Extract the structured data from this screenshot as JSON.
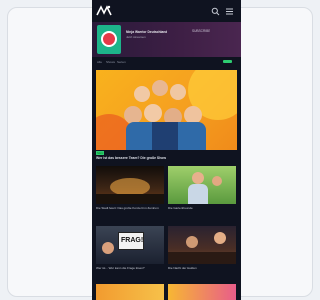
{
  "promo": {
    "title": "Ninja Warrior Deutschland",
    "subtitle": "Jetzt streamen",
    "cta": "SUBSCRIBE"
  },
  "sections": [
    "Alle",
    "Shows",
    "Serien"
  ],
  "hero": {
    "tag": "NEU",
    "caption": "Wer ist das bessere Team? Die große Show"
  },
  "tiles": [
    {
      "caption": "Die Stadt feiert: Das große Konzert im Zentrum",
      "sub": ""
    },
    {
      "caption": "Die Gartenfreunde",
      "sub": ""
    },
    {
      "caption": "Wer ist... Wer kann die Frage lösen?",
      "sub": ""
    },
    {
      "caption": "Die Nacht der Helden",
      "sub": ""
    }
  ],
  "tile_labels": {
    "tile3_sign": "FRAG!"
  },
  "icons": {
    "logo": "brand-logo-icon",
    "search": "search-icon",
    "menu": "menu-icon"
  },
  "colors": {
    "background": "#0f1320",
    "accent": "#2ecc71",
    "hero": "#f9b21d"
  }
}
